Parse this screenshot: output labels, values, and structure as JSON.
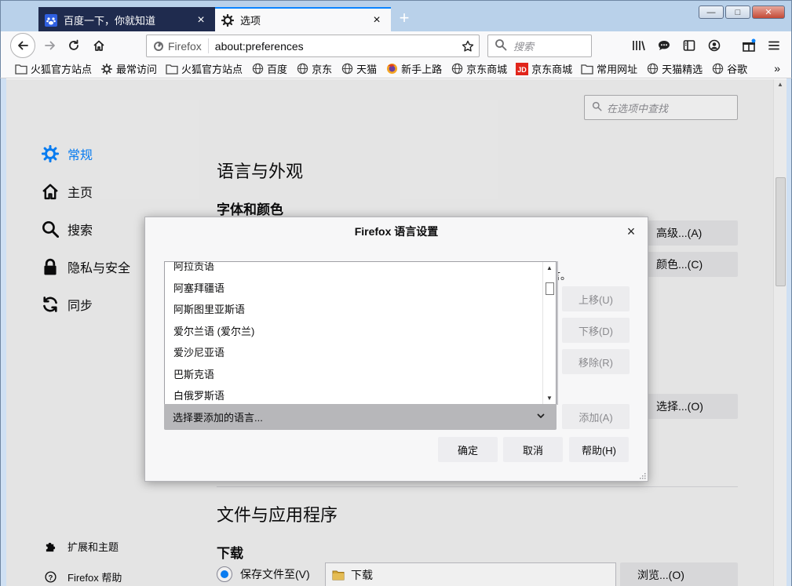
{
  "tabs": [
    {
      "label": "百度一下，你就知道",
      "close": "×"
    },
    {
      "label": "选项",
      "close": "×"
    }
  ],
  "new_tab": "+",
  "window_buttons": {
    "minimize": "—",
    "restore": "□",
    "close": "✕"
  },
  "urlbar": {
    "identity": "Firefox",
    "url": "about:preferences"
  },
  "searchbar": {
    "placeholder": "搜索"
  },
  "bookmarks": [
    {
      "label": "火狐官方站点",
      "icon": "folder-icon"
    },
    {
      "label": "最常访问",
      "icon": "gear-icon"
    },
    {
      "label": "火狐官方站点",
      "icon": "folder-icon"
    },
    {
      "label": "百度",
      "icon": "globe-icon"
    },
    {
      "label": "京东",
      "icon": "globe-icon"
    },
    {
      "label": "天猫",
      "icon": "globe-icon"
    },
    {
      "label": "新手上路",
      "icon": "firefox-icon"
    },
    {
      "label": "京东商城",
      "icon": "globe-icon"
    },
    {
      "label": "京东商城",
      "icon": "jd-icon"
    },
    {
      "label": "常用网址",
      "icon": "folder-icon"
    },
    {
      "label": "天猫精选",
      "icon": "globe-icon"
    },
    {
      "label": "谷歌",
      "icon": "globe-icon"
    }
  ],
  "bookmarks_more": "»",
  "prefs": {
    "find_placeholder": "在选项中查找",
    "categories": {
      "general": "常规",
      "home": "主页",
      "search": "搜索",
      "privacy": "隐私与安全",
      "sync": "同步"
    },
    "footer": {
      "addons": "扩展和主题",
      "help": "Firefox 帮助"
    },
    "section_language": "语言与外观",
    "fonts_colors": "字体和颜色",
    "advanced_btn": "高级...(A)",
    "colors_btn": "颜色...(C)",
    "choose_btn": "选择...(O)",
    "section_files": "文件与应用程序",
    "downloads": "下载",
    "save_files_to": "保存文件至(V)",
    "download_folder": "下载",
    "browse_btn": "浏览...(O)"
  },
  "dialog": {
    "title": "Firefox 语言设置",
    "close": "×",
    "hidden_text": "言。",
    "languages": [
      "阿拉贡语",
      "阿塞拜疆语",
      "阿斯图里亚斯语",
      "爱尔兰语 (爱尔兰)",
      "爱沙尼亚语",
      "巴斯克语",
      "白俄罗斯语"
    ],
    "move_up": "上移(U)",
    "move_down": "下移(D)",
    "remove": "移除(R)",
    "select_placeholder": "选择要添加的语言...",
    "add": "添加(A)",
    "ok": "确定",
    "cancel": "取消",
    "help": "帮助(H)"
  }
}
